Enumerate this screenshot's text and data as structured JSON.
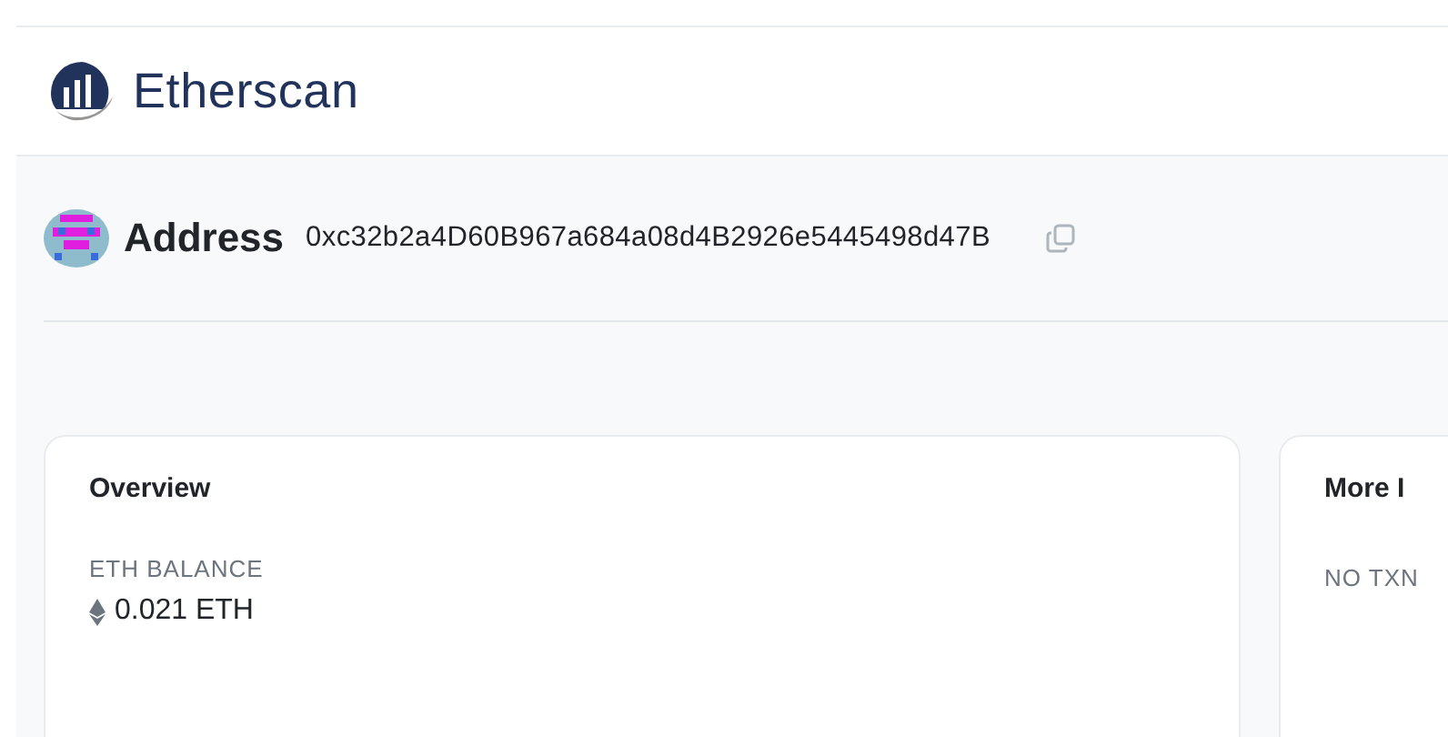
{
  "header": {
    "logo_text": "Etherscan"
  },
  "address": {
    "label": "Address",
    "value": "0xc32b2a4D60B967a684a08d4B2926e5445498d47B"
  },
  "cards": [
    {
      "title": "Overview",
      "fields": [
        {
          "label": "ETH BALANCE",
          "value": "0.021 ETH"
        }
      ]
    },
    {
      "title": "More I",
      "fields": [
        {
          "label": "NO TXN"
        }
      ]
    }
  ]
}
